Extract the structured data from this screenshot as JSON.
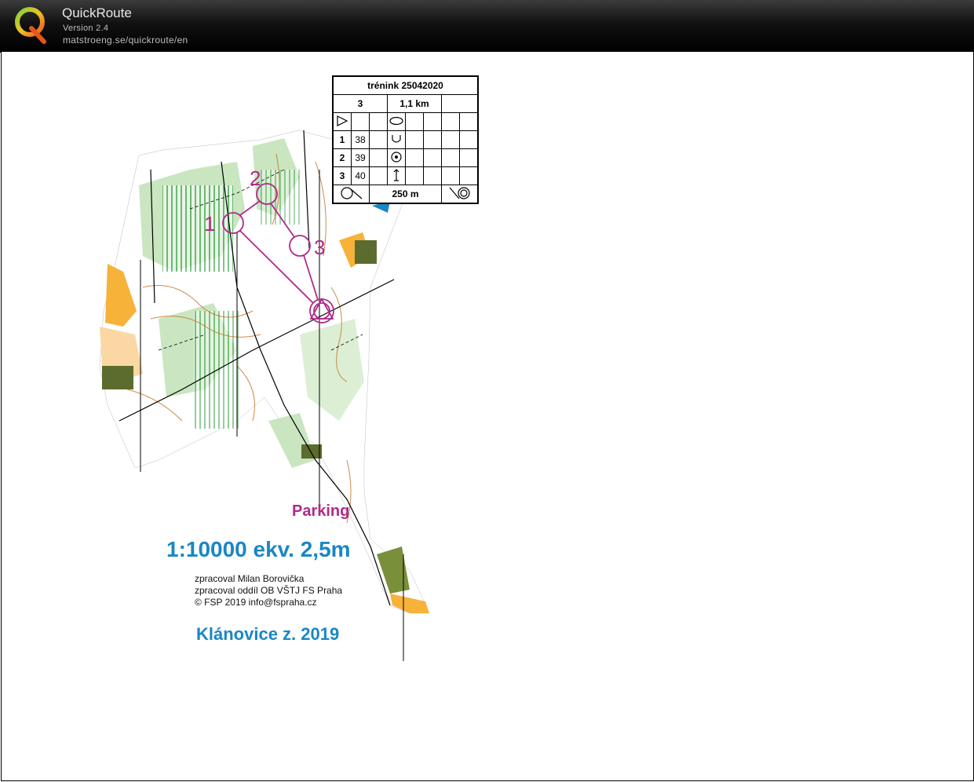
{
  "app": {
    "title": "QuickRoute",
    "version": "Version 2.4",
    "url": "matstroeng.se/quickroute/en"
  },
  "map": {
    "course_labels": [
      "1",
      "2",
      "3"
    ],
    "parking_label": "Parking",
    "scale_label": "1:10000 ekv. 2,5m",
    "credits": [
      "zpracoval Milan Borovička",
      "zpracoval oddíl OB VŠTJ FS Praha",
      "© FSP 2019  info@fspraha.cz"
    ],
    "map_name": "Klánovice z. 2019",
    "colors": {
      "course": "#b02a8a",
      "water": "#1a87c4",
      "vegetation": "#c9e6c0",
      "open_land": "#f7b23a",
      "contour": "#c4762b"
    }
  },
  "description_sheet": {
    "title": "trénink 25042020",
    "course_number": "3",
    "length": "1,1 km",
    "start_symbol": "triangle",
    "start_feature_symbol": "ellipse",
    "controls": [
      {
        "number": "1",
        "code": "38",
        "symbol": "cup"
      },
      {
        "number": "2",
        "code": "39",
        "symbol": "circle-dot"
      },
      {
        "number": "3",
        "code": "40",
        "symbol": "arrow-up"
      }
    ],
    "finish_distance": "250 m"
  }
}
